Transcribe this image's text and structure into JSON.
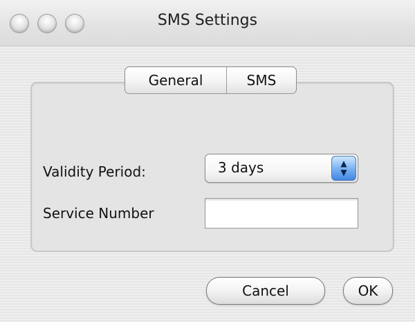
{
  "window": {
    "title": "SMS Settings",
    "controls": [
      "close-button",
      "minimize-button",
      "zoom-button"
    ]
  },
  "tabs": {
    "items": [
      {
        "label": "General",
        "selected": true
      },
      {
        "label": "SMS",
        "selected": false
      }
    ]
  },
  "form": {
    "validity_label": "Validity Period:",
    "validity_value": "3 days",
    "service_label": "Service Number",
    "service_value": ""
  },
  "buttons": {
    "cancel": "Cancel",
    "ok": "OK"
  },
  "colors": {
    "popup_arrow_accent": "#3f86e3"
  }
}
